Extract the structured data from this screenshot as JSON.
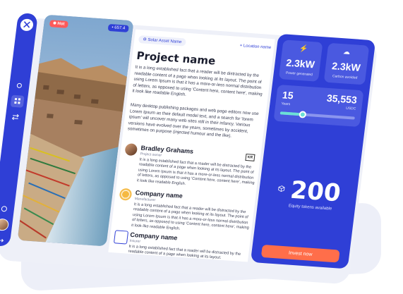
{
  "photo": {
    "hot_label": "Hot",
    "tag_label": "• 657.4"
  },
  "header": {
    "asset_tag": "Solar Asset Name",
    "location": "Location name"
  },
  "project": {
    "name": "Project name",
    "desc1": "It is a long established fact that a reader will be distracted by the readable content of a page when looking at its layout. The point of using Lorem Ipsum is that it has a more-or-less normal distribution of letters, as opposed to using 'Content here, content here', making it look like readable English.",
    "desc2": "Many desktop publishing packages and web page editors now use Lorem Ipsum as their default model text, and a search for 'lorem ipsum' will uncover many web sites still in their infancy. Various versions have evolved over the years, sometimes by accident, sometimes on purpose (injected humour and the like)."
  },
  "people": [
    {
      "name": "Bradley Grahams",
      "role": "Project owner",
      "brand": "KR",
      "text": "It is a long established fact that a reader will be distracted by the readable content of a page when looking at its layout. The point of using Lorem Ipsum is that it has a more-or-less normal distribution of letters, as opposed to using 'Content here, content here', making it look like readable English."
    },
    {
      "name": "Company name",
      "role": "Manufacturer",
      "text": "It is a long established fact that a reader will be distracted by the readable content of a page when looking at its layout. The point of using Lorem Ipsum is that it has a more-or-less normal distribution of letters, as opposed to using 'Content here, content here', making it look like readable English."
    },
    {
      "name": "Company name",
      "role": "Insurer",
      "text": "It is a long established fact that a reader will be distracted by the readable content of a page when looking at its layout."
    }
  ],
  "stats": {
    "power_value": "2.3kW",
    "power_label": "Power generated",
    "carbon_value": "2.3kW",
    "carbon_label": "Carbon avoided",
    "years_value": "15",
    "years_label": "Years",
    "usdc_value": "35,553",
    "usdc_label": "USDC",
    "slider_fraction": 0.3,
    "tokens_value": "200",
    "tokens_label": "Equity tokens available",
    "invest_label": "Invest now"
  },
  "colors": {
    "primary": "#2f3fd6",
    "accent": "#ff6e4a",
    "hot": "#ff5a5a"
  }
}
